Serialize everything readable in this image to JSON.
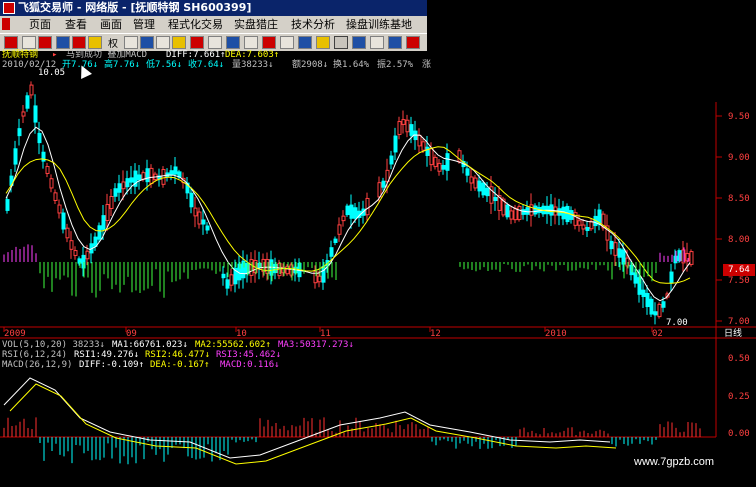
{
  "window": {
    "title": "飞狐交易师 - 网络版 - [抚顺特钢 SH600399]"
  },
  "menu": [
    "页面",
    "查看",
    "画面",
    "管理",
    "程式化交易",
    "实盘猎庄",
    "技术分析",
    "操盘训练基地"
  ],
  "toolbar": {
    "quote_label": "权"
  },
  "stock": {
    "name": "抚顺特钢",
    "indicator_arrow": "▸",
    "overlay_text": "马到成功 叠加MACD",
    "diff": "DIFF:7.661↑",
    "dea": "DEA:7.603↑"
  },
  "ohlc": {
    "date": "2010/02/12",
    "open": "开7.76↓",
    "high": "高7.76↓",
    "low": "低7.56↓",
    "close": "收7.64↓",
    "volume": "量38233↓",
    "amount": "额2908↓",
    "turnover": "换1.64%",
    "amplitude": "振2.57%",
    "more": "涨"
  },
  "price_axis": {
    "labels": [
      "9.50",
      "9.00",
      "8.50",
      "8.00",
      "7.50",
      "7.00"
    ],
    "current_price": "7.64",
    "high_marker": "10.05",
    "low_marker": "7.00"
  },
  "time_axis": {
    "labels": [
      "2009",
      "09",
      "10",
      "11",
      "12",
      "2010",
      "02"
    ],
    "period": "日线"
  },
  "vol_line": {
    "label": "VOL(5,10,20) 38233↓",
    "ma1": "MA1:66761.023↓",
    "ma2": "MA2:55562.602↑",
    "ma3": "MA3:50317.273↓"
  },
  "rsi_line": {
    "label": "RSI(6,12,24)",
    "rsi1": "RSI1:49.276↓",
    "rsi2": "RSI2:46.477↓",
    "rsi3": "RSI3:45.462↓"
  },
  "macd_line": {
    "label": "MACD(26,12,9)",
    "diff": "DIFF:-0.109↑",
    "dea": "DEA:-0.167↑",
    "macd": "MACD:0.116↓"
  },
  "macd_axis": {
    "labels": [
      "0.50",
      "0.25",
      "0.00"
    ]
  },
  "watermark": "www.7gpzb.com",
  "colors": {
    "up": "#ff4040",
    "down": "#00ffff",
    "ma_white": "#ffffff",
    "ma_yellow": "#ffff00",
    "axis": "#c00000",
    "macd_pos": "#ff3030",
    "macd_neg": "#00ffff",
    "bar_green": "#40ff40",
    "bar_magenta": "#ff40ff"
  }
}
